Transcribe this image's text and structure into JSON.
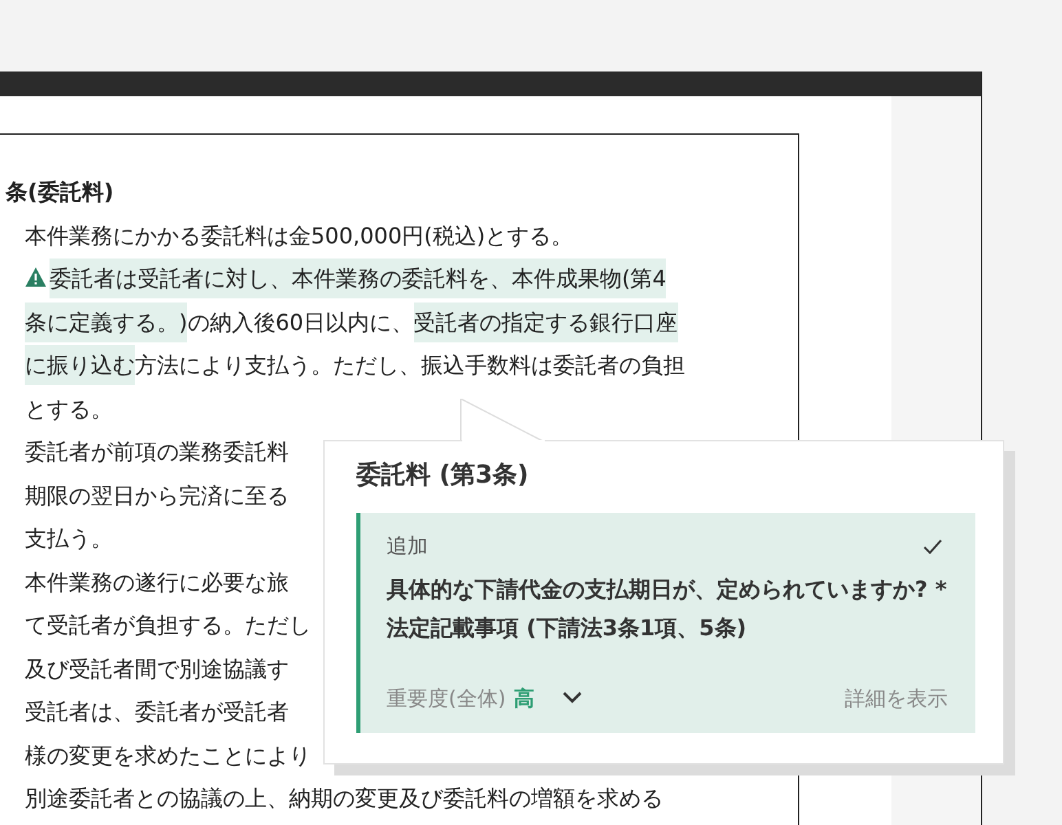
{
  "document": {
    "heading": "条(委託料)",
    "lines": [
      {
        "warning": false,
        "segments": [
          {
            "text": "本件業務にかかる委託料は金500,000円(税込)とする。",
            "highlighted": false
          }
        ]
      },
      {
        "warning": true,
        "segments": [
          {
            "text": "委託者は受託者に対し、本件業務の委託料を、本件成果物(第4",
            "highlighted": true
          }
        ]
      },
      {
        "warning": false,
        "segments": [
          {
            "text": "条に定義する。)",
            "highlighted": true
          },
          {
            "text": "の納入後60日以内に、",
            "highlighted": false
          },
          {
            "text": "受託者の指定する銀行口座",
            "highlighted": true
          }
        ]
      },
      {
        "warning": false,
        "segments": [
          {
            "text": "に振り込む",
            "highlighted": true
          },
          {
            "text": "方法により支払う。ただし、振込手数料は委託者の負担",
            "highlighted": false
          }
        ]
      },
      {
        "warning": false,
        "segments": [
          {
            "text": "とする。",
            "highlighted": false
          }
        ]
      },
      {
        "warning": false,
        "segments": [
          {
            "text": "委託者が前項の業務委託料",
            "highlighted": false
          }
        ]
      },
      {
        "warning": false,
        "segments": [
          {
            "text": "期限の翌日から完済に至る",
            "highlighted": false
          }
        ]
      },
      {
        "warning": false,
        "segments": [
          {
            "text": "支払う。",
            "highlighted": false
          }
        ]
      },
      {
        "warning": false,
        "segments": [
          {
            "text": "本件業務の遂行に必要な旅",
            "highlighted": false
          }
        ]
      },
      {
        "warning": false,
        "segments": [
          {
            "text": "て受託者が負担する。ただし",
            "highlighted": false
          }
        ]
      },
      {
        "warning": false,
        "segments": [
          {
            "text": "及び受託者間で別途協議す",
            "highlighted": false
          }
        ]
      },
      {
        "warning": false,
        "segments": [
          {
            "text": "受託者は、委託者が受託者",
            "highlighted": false
          }
        ]
      },
      {
        "warning": false,
        "segments": [
          {
            "text": "様の変更を求めたことにより",
            "highlighted": false
          }
        ]
      },
      {
        "warning": false,
        "segments": [
          {
            "text": "別途委託者との協議の上、納期の変更及び委託料の増額を求める",
            "highlighted": false
          }
        ]
      }
    ]
  },
  "popup": {
    "title": "委託料 (第3条)",
    "card": {
      "label": "追加",
      "checked": true,
      "question": "具体的な下請代金の支払期日が、定められていますか? *法定記載事項 (下請法3条1項、5条)",
      "importance_label": "重要度(全体)",
      "importance": "高",
      "expanded": false,
      "details_link": "詳細を表示"
    }
  }
}
